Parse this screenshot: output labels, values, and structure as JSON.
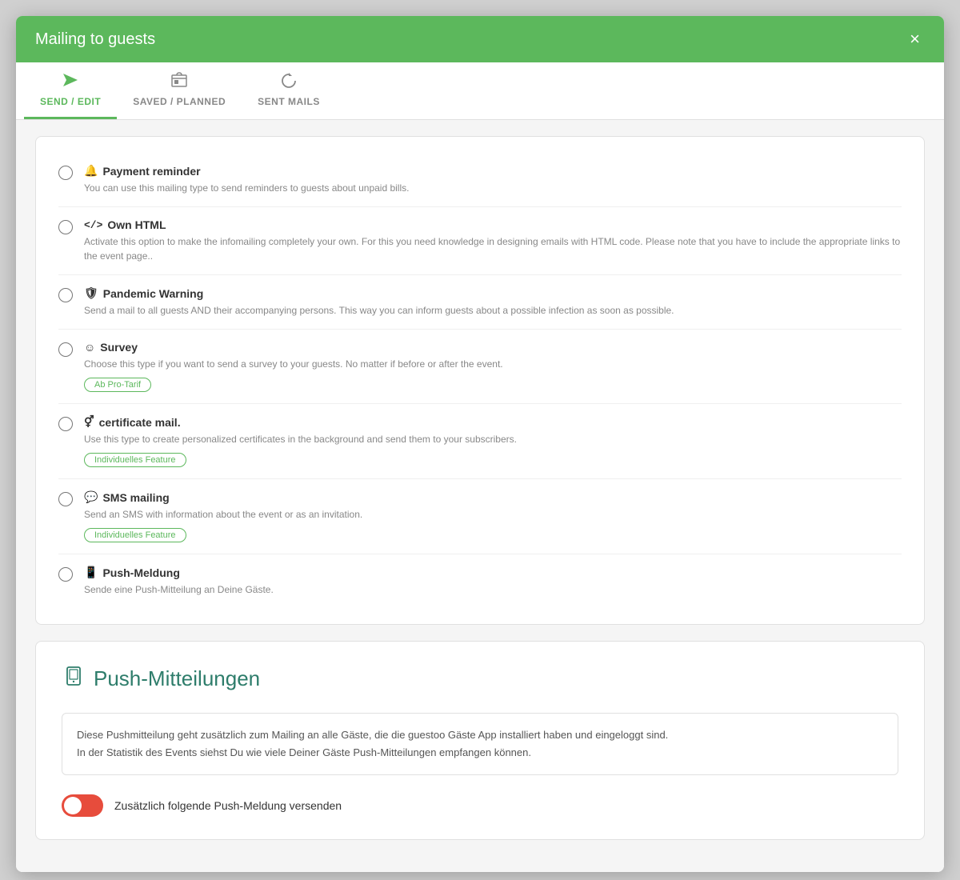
{
  "modal": {
    "title": "Mailing to guests",
    "close_label": "×"
  },
  "tabs": [
    {
      "id": "send-edit",
      "label": "SEND / EDIT",
      "icon": "✈",
      "active": true
    },
    {
      "id": "saved-planned",
      "label": "SAVED / PLANNED",
      "icon": "📁",
      "active": false
    },
    {
      "id": "sent-mails",
      "label": "SENT MAILS",
      "icon": "↺",
      "active": false
    }
  ],
  "options": [
    {
      "id": "payment-reminder",
      "icon": "🔔",
      "title": "Payment reminder",
      "desc": "You can use this mailing type to send reminders to guests about unpaid bills.",
      "badge": null
    },
    {
      "id": "own-html",
      "icon": "</>",
      "title": "Own HTML",
      "desc": "Activate this option to make the infomailing completely your own. For this you need knowledge in designing emails with HTML code. Please note that you have to include the appropriate links to the event page..",
      "badge": null
    },
    {
      "id": "pandemic-warning",
      "icon": "🛡",
      "title": "Pandemic Warning",
      "desc": "Send a mail to all guests AND their accompanying persons. This way you can inform guests about a possible infection as soon as possible.",
      "badge": null
    },
    {
      "id": "survey",
      "icon": "😊",
      "title": "Survey",
      "desc": "Choose this type if you want to send a survey to your guests. No matter if before or after the event.",
      "badge": "Ab Pro-Tarif"
    },
    {
      "id": "certificate-mail",
      "icon": "♂",
      "title": "certificate mail.",
      "desc": "Use this type to create personalized certificates in the background and send them to your subscribers.",
      "badge": "Individuelles Feature"
    },
    {
      "id": "sms-mailing",
      "icon": "💬",
      "title": "SMS mailing",
      "desc": "Send an SMS with information about the event or as an invitation.",
      "badge": "Individuelles Feature"
    },
    {
      "id": "push-meldung",
      "icon": "📱",
      "title": "Push-Meldung",
      "desc": "Sende eine Push-Mitteilung an Deine Gäste.",
      "badge": null
    }
  ],
  "push_section": {
    "icon": "📱",
    "title": "Push-Mitteilungen",
    "info_line1": "Diese Pushmitteilung geht zusätzlich zum Mailing an alle Gäste, die die guestoo Gäste App installiert haben und eingeloggt sind.",
    "info_line2": "In der Statistik des Events siehst Du wie viele Deiner Gäste Push-Mitteilungen empfangen können.",
    "toggle_label": "Zusätzlich folgende Push-Meldung versenden",
    "toggle_checked": true
  }
}
